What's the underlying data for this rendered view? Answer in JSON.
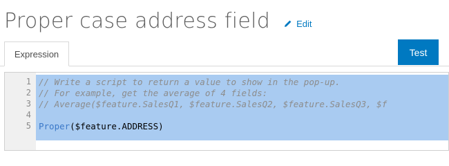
{
  "header": {
    "title": "Proper case address field",
    "edit_label": "Edit"
  },
  "tabs": [
    {
      "label": "Expression",
      "active": true
    }
  ],
  "toolbar": {
    "test_label": "Test"
  },
  "editor": {
    "lines": [
      {
        "number": "1",
        "text": "// Write a script to return a value to show in the pop-up."
      },
      {
        "number": "2",
        "text": "// For example, get the average of 4 fields:"
      },
      {
        "number": "3",
        "text": "// Average($feature.SalesQ1, $feature.SalesQ2, $feature.SalesQ3, $f"
      },
      {
        "number": "4",
        "text": ""
      },
      {
        "number": "5",
        "function": "Proper",
        "args": "($feature.ADDRESS)"
      }
    ]
  },
  "colors": {
    "accent": "#0079c1",
    "selection": "#a9cbf1",
    "comment": "#8c8c8c",
    "function": "#3a78c8"
  }
}
